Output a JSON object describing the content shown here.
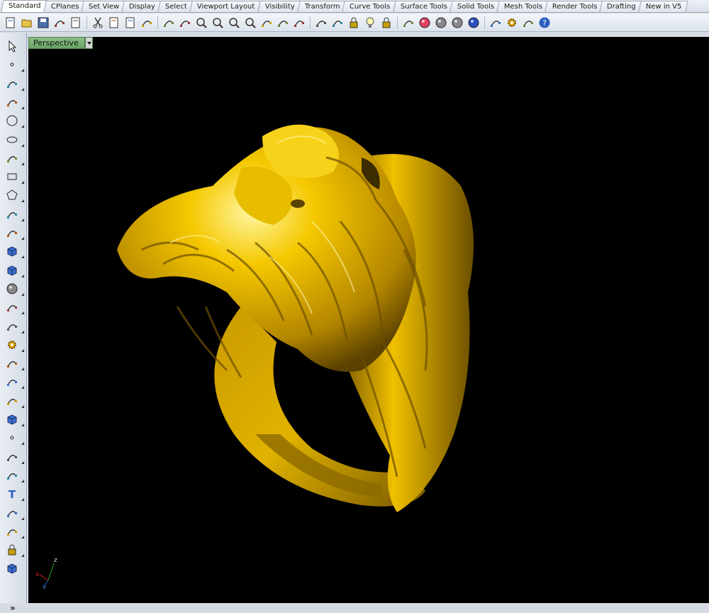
{
  "tabs": [
    {
      "label": "Standard",
      "active": true
    },
    {
      "label": "CPlanes"
    },
    {
      "label": "Set View"
    },
    {
      "label": "Display"
    },
    {
      "label": "Select"
    },
    {
      "label": "Viewport Layout"
    },
    {
      "label": "Visibility"
    },
    {
      "label": "Transform"
    },
    {
      "label": "Curve Tools"
    },
    {
      "label": "Surface Tools"
    },
    {
      "label": "Solid Tools"
    },
    {
      "label": "Mesh Tools"
    },
    {
      "label": "Render Tools"
    },
    {
      "label": "Drafting"
    },
    {
      "label": "New in V5"
    }
  ],
  "toolbar_icons": [
    "new-icon",
    "open-icon",
    "save-icon",
    "print-icon",
    "import-icon",
    "cut-icon",
    "copy-icon",
    "paste-icon",
    "undo-icon",
    "pan-icon",
    "rotate-view-icon",
    "zoom-icon",
    "zoom-window-icon",
    "zoom-extents-icon",
    "zoom-selected-icon",
    "undo-view-icon",
    "four-viewports-icon",
    "car-icon",
    "hide-icon",
    "show-icon",
    "lock-icon",
    "light-icon",
    "lock-objects-icon",
    "layers-icon",
    "color-wheel-icon",
    "shaded-sphere-icon",
    "rendered-sphere-icon",
    "blue-sphere-icon",
    "properties-icon",
    "options-icon",
    "group-icon",
    "help-icon"
  ],
  "left_tool_icons": [
    "select-icon",
    "point-icon",
    "polyline-icon",
    "curve-icon",
    "circle-icon",
    "ellipse-icon",
    "arc-icon",
    "rectangle-icon",
    "polygon-icon",
    "fillet-curve-icon",
    "surface-icon",
    "extrude-icon",
    "box-icon",
    "sphere-icon",
    "cylinder-icon",
    "mesh-icon",
    "gear-icon",
    "boolean-icon",
    "split-icon",
    "trim-icon",
    "solid-icon",
    "points-icon",
    "bend-icon",
    "offset-icon",
    "text-icon",
    "dimension-icon",
    "array-icon",
    "block-icon",
    "render-box-icon"
  ],
  "more_glyph": "»",
  "viewport": {
    "title": "Perspective",
    "axes": {
      "x": "x",
      "y": "y",
      "z": "z"
    }
  },
  "colors": {
    "viewport_bg": "#000000",
    "title_bg": "#7db278",
    "gold": "#f2c200"
  }
}
